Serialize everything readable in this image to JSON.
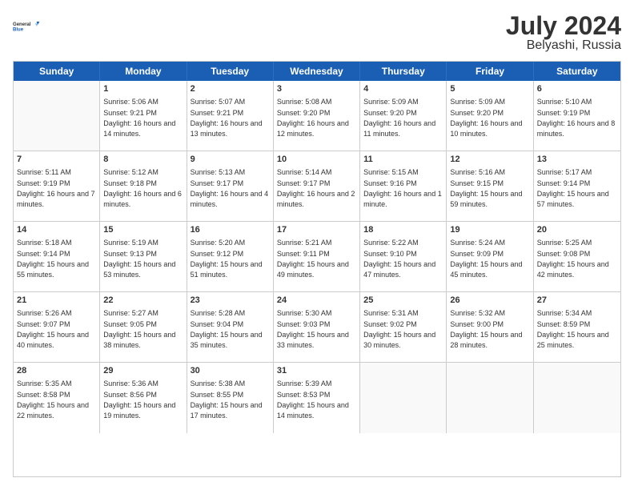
{
  "header": {
    "logo_general": "General",
    "logo_blue": "Blue",
    "month_year": "July 2024",
    "location": "Belyashi, Russia"
  },
  "weekdays": [
    "Sunday",
    "Monday",
    "Tuesday",
    "Wednesday",
    "Thursday",
    "Friday",
    "Saturday"
  ],
  "weeks": [
    [
      {
        "day": "",
        "sunrise": "",
        "sunset": "",
        "daylight": ""
      },
      {
        "day": "1",
        "sunrise": "Sunrise: 5:06 AM",
        "sunset": "Sunset: 9:21 PM",
        "daylight": "Daylight: 16 hours and 14 minutes."
      },
      {
        "day": "2",
        "sunrise": "Sunrise: 5:07 AM",
        "sunset": "Sunset: 9:21 PM",
        "daylight": "Daylight: 16 hours and 13 minutes."
      },
      {
        "day": "3",
        "sunrise": "Sunrise: 5:08 AM",
        "sunset": "Sunset: 9:20 PM",
        "daylight": "Daylight: 16 hours and 12 minutes."
      },
      {
        "day": "4",
        "sunrise": "Sunrise: 5:09 AM",
        "sunset": "Sunset: 9:20 PM",
        "daylight": "Daylight: 16 hours and 11 minutes."
      },
      {
        "day": "5",
        "sunrise": "Sunrise: 5:09 AM",
        "sunset": "Sunset: 9:20 PM",
        "daylight": "Daylight: 16 hours and 10 minutes."
      },
      {
        "day": "6",
        "sunrise": "Sunrise: 5:10 AM",
        "sunset": "Sunset: 9:19 PM",
        "daylight": "Daylight: 16 hours and 8 minutes."
      }
    ],
    [
      {
        "day": "7",
        "sunrise": "Sunrise: 5:11 AM",
        "sunset": "Sunset: 9:19 PM",
        "daylight": "Daylight: 16 hours and 7 minutes."
      },
      {
        "day": "8",
        "sunrise": "Sunrise: 5:12 AM",
        "sunset": "Sunset: 9:18 PM",
        "daylight": "Daylight: 16 hours and 6 minutes."
      },
      {
        "day": "9",
        "sunrise": "Sunrise: 5:13 AM",
        "sunset": "Sunset: 9:17 PM",
        "daylight": "Daylight: 16 hours and 4 minutes."
      },
      {
        "day": "10",
        "sunrise": "Sunrise: 5:14 AM",
        "sunset": "Sunset: 9:17 PM",
        "daylight": "Daylight: 16 hours and 2 minutes."
      },
      {
        "day": "11",
        "sunrise": "Sunrise: 5:15 AM",
        "sunset": "Sunset: 9:16 PM",
        "daylight": "Daylight: 16 hours and 1 minute."
      },
      {
        "day": "12",
        "sunrise": "Sunrise: 5:16 AM",
        "sunset": "Sunset: 9:15 PM",
        "daylight": "Daylight: 15 hours and 59 minutes."
      },
      {
        "day": "13",
        "sunrise": "Sunrise: 5:17 AM",
        "sunset": "Sunset: 9:14 PM",
        "daylight": "Daylight: 15 hours and 57 minutes."
      }
    ],
    [
      {
        "day": "14",
        "sunrise": "Sunrise: 5:18 AM",
        "sunset": "Sunset: 9:14 PM",
        "daylight": "Daylight: 15 hours and 55 minutes."
      },
      {
        "day": "15",
        "sunrise": "Sunrise: 5:19 AM",
        "sunset": "Sunset: 9:13 PM",
        "daylight": "Daylight: 15 hours and 53 minutes."
      },
      {
        "day": "16",
        "sunrise": "Sunrise: 5:20 AM",
        "sunset": "Sunset: 9:12 PM",
        "daylight": "Daylight: 15 hours and 51 minutes."
      },
      {
        "day": "17",
        "sunrise": "Sunrise: 5:21 AM",
        "sunset": "Sunset: 9:11 PM",
        "daylight": "Daylight: 15 hours and 49 minutes."
      },
      {
        "day": "18",
        "sunrise": "Sunrise: 5:22 AM",
        "sunset": "Sunset: 9:10 PM",
        "daylight": "Daylight: 15 hours and 47 minutes."
      },
      {
        "day": "19",
        "sunrise": "Sunrise: 5:24 AM",
        "sunset": "Sunset: 9:09 PM",
        "daylight": "Daylight: 15 hours and 45 minutes."
      },
      {
        "day": "20",
        "sunrise": "Sunrise: 5:25 AM",
        "sunset": "Sunset: 9:08 PM",
        "daylight": "Daylight: 15 hours and 42 minutes."
      }
    ],
    [
      {
        "day": "21",
        "sunrise": "Sunrise: 5:26 AM",
        "sunset": "Sunset: 9:07 PM",
        "daylight": "Daylight: 15 hours and 40 minutes."
      },
      {
        "day": "22",
        "sunrise": "Sunrise: 5:27 AM",
        "sunset": "Sunset: 9:05 PM",
        "daylight": "Daylight: 15 hours and 38 minutes."
      },
      {
        "day": "23",
        "sunrise": "Sunrise: 5:28 AM",
        "sunset": "Sunset: 9:04 PM",
        "daylight": "Daylight: 15 hours and 35 minutes."
      },
      {
        "day": "24",
        "sunrise": "Sunrise: 5:30 AM",
        "sunset": "Sunset: 9:03 PM",
        "daylight": "Daylight: 15 hours and 33 minutes."
      },
      {
        "day": "25",
        "sunrise": "Sunrise: 5:31 AM",
        "sunset": "Sunset: 9:02 PM",
        "daylight": "Daylight: 15 hours and 30 minutes."
      },
      {
        "day": "26",
        "sunrise": "Sunrise: 5:32 AM",
        "sunset": "Sunset: 9:00 PM",
        "daylight": "Daylight: 15 hours and 28 minutes."
      },
      {
        "day": "27",
        "sunrise": "Sunrise: 5:34 AM",
        "sunset": "Sunset: 8:59 PM",
        "daylight": "Daylight: 15 hours and 25 minutes."
      }
    ],
    [
      {
        "day": "28",
        "sunrise": "Sunrise: 5:35 AM",
        "sunset": "Sunset: 8:58 PM",
        "daylight": "Daylight: 15 hours and 22 minutes."
      },
      {
        "day": "29",
        "sunrise": "Sunrise: 5:36 AM",
        "sunset": "Sunset: 8:56 PM",
        "daylight": "Daylight: 15 hours and 19 minutes."
      },
      {
        "day": "30",
        "sunrise": "Sunrise: 5:38 AM",
        "sunset": "Sunset: 8:55 PM",
        "daylight": "Daylight: 15 hours and 17 minutes."
      },
      {
        "day": "31",
        "sunrise": "Sunrise: 5:39 AM",
        "sunset": "Sunset: 8:53 PM",
        "daylight": "Daylight: 15 hours and 14 minutes."
      },
      {
        "day": "",
        "sunrise": "",
        "sunset": "",
        "daylight": ""
      },
      {
        "day": "",
        "sunrise": "",
        "sunset": "",
        "daylight": ""
      },
      {
        "day": "",
        "sunrise": "",
        "sunset": "",
        "daylight": ""
      }
    ]
  ]
}
